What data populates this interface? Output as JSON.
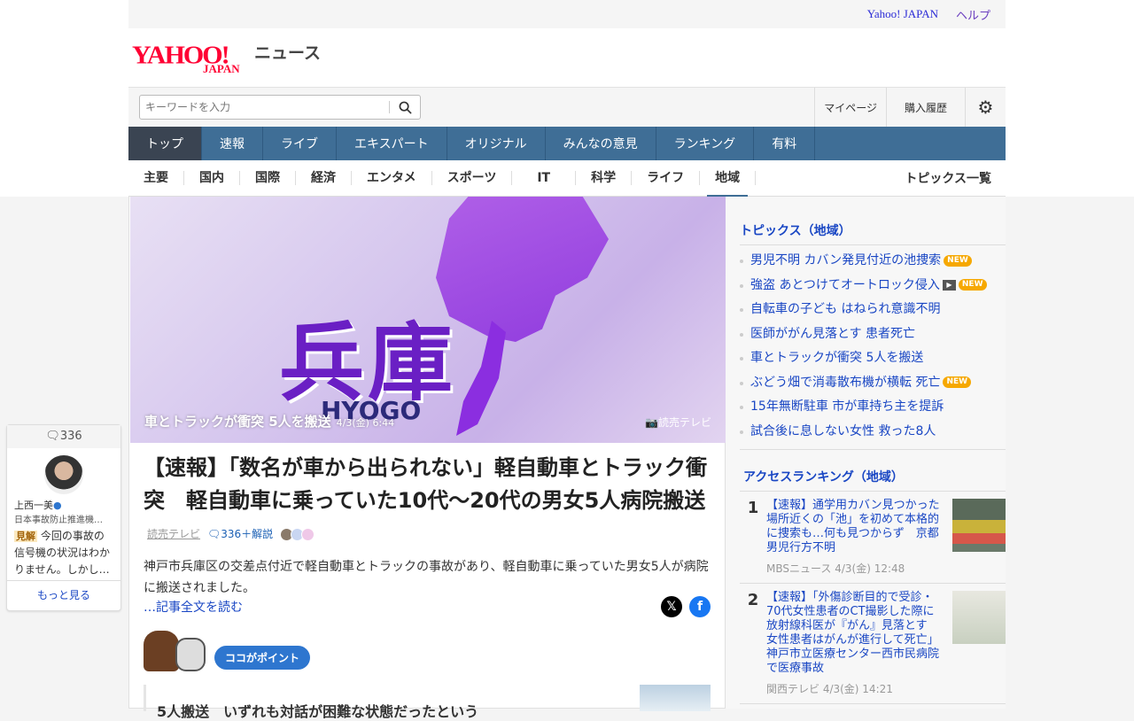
{
  "topbar": {
    "yahoo_japan": "Yahoo! JAPAN",
    "help": "ヘルプ"
  },
  "logo": {
    "brand": "YAHOO!",
    "sub": "JAPAN",
    "service": "ニュース"
  },
  "search": {
    "placeholder": "キーワードを入力"
  },
  "header_links": {
    "mypage": "マイページ",
    "purchase": "購入履歴"
  },
  "main_nav": [
    "トップ",
    "速報",
    "ライブ",
    "エキスパート",
    "オリジナル",
    "みんなの意見",
    "ランキング",
    "有料"
  ],
  "sub_nav": [
    "主要",
    "国内",
    "国際",
    "経済",
    "エンタメ",
    "スポーツ",
    "IT",
    "科学",
    "ライフ",
    "地域"
  ],
  "sub_nav_all": "トピックス一覧",
  "hero": {
    "kanji": "兵庫",
    "en": "HYOGO",
    "caption": "車とトラックが衝突 5人を搬送",
    "time": "4/3(金) 6:44",
    "credit": "読売テレビ"
  },
  "article": {
    "title": "【速報】「数名が車から出られない」軽自動車とトラック衝突　軽自動車に乗っていた10代～20代の男女5人病院搬送",
    "source": "読売テレビ",
    "comments": "336＋解説",
    "summary": "神戸市兵庫区の交差点付近で軽自動車とトラックの事故があり、軽自動車に乗っていた男女5人が病院に搬送されました。",
    "read_more": "…記事全文を読む",
    "point_label": "ココがポイント",
    "point_text": "5人搬送　いずれも対話が困難な状態だったという"
  },
  "comment_card": {
    "count": "336",
    "name": "上西一美",
    "org": "日本事故防止推進機…",
    "badge": "見解",
    "text": "今回の事故の信号機の状況はわかりません。しかし…",
    "more": "もっと見る"
  },
  "topics": {
    "heading": "トピックス（地域）",
    "items": [
      {
        "text": "男児不明 カバン発見付近の池捜索",
        "new": "NEW"
      },
      {
        "text": "強盗 あとつけてオートロック侵入",
        "video": true,
        "new": "NEW"
      },
      {
        "text": "自転車の子ども はねられ意識不明"
      },
      {
        "text": "医師ががん見落とす 患者死亡"
      },
      {
        "text": "車とトラックが衝突 5人を搬送"
      },
      {
        "text": "ぶどう畑で消毒散布機が横転 死亡",
        "new": "NEW"
      },
      {
        "text": "15年無断駐車 市が車持ち主を提訴"
      },
      {
        "text": "試合後に息しない女性 救った8人"
      }
    ]
  },
  "ranking": {
    "heading": "アクセスランキング（地域）",
    "items": [
      {
        "rank": "1",
        "title": "【速報】通学用カバン見つかった場所近くの「池」を初めて本格的に捜索も…何も見つからず　京都 男児行方不明",
        "meta": "MBSニュース 4/3(金) 12:48"
      },
      {
        "rank": "2",
        "title": "【速報】「外傷診断目的で受診・70代女性患者のCT撮影した際に放射線科医が『がん』見落とす　女性患者はがんが進行して死亡」神戸市立医療センター西市民病院で医療事故",
        "meta": "関西テレビ 4/3(金) 14:21"
      }
    ]
  }
}
